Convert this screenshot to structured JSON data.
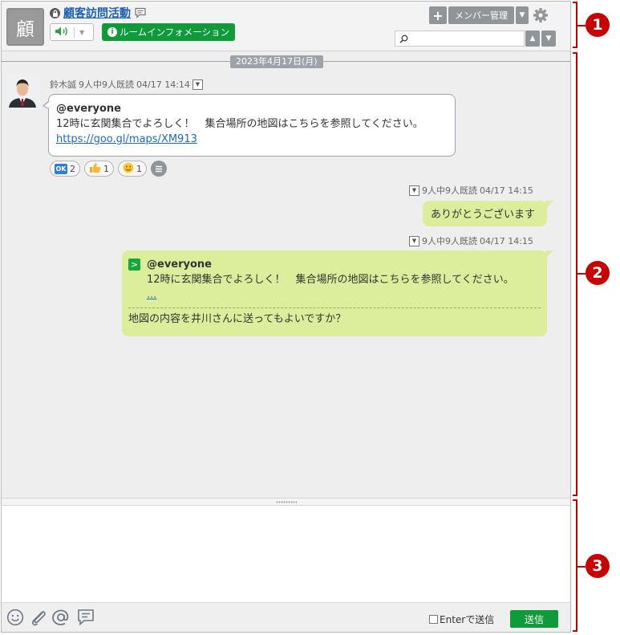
{
  "header": {
    "room_avatar_text": "顧",
    "room_title": "顧客訪問活動",
    "room_info_label": "ルームインフォメーション",
    "member_manage_label": "メンバー管理",
    "search_placeholder": ""
  },
  "timeline": {
    "date_label": "2023年4月17日(月)",
    "messages": [
      {
        "sender": "鈴木誠",
        "read_status": "9人中9人既読",
        "timestamp": "04/17 14:14",
        "mention": "@everyone",
        "body": "12時に玄関集合でよろしく！　集合場所の地図はこちらを参照してください。",
        "link": "https://goo.gl/maps/XM913",
        "reactions": [
          {
            "icon": "ok-icon",
            "count": "2"
          },
          {
            "icon": "thumbs-up-icon",
            "count": "1"
          },
          {
            "icon": "smile-icon",
            "count": "1"
          }
        ]
      },
      {
        "read_status": "9人中9人既読",
        "timestamp": "04/17 14:15",
        "body": "ありがとうございます"
      },
      {
        "read_status": "9人中9人既読",
        "timestamp": "04/17 14:15",
        "quote_mention": "@everyone",
        "quote_body": "12時に玄関集合でよろしく！　集合場所の地図はこちらを参照してください。",
        "quote_ellipsis": "...",
        "body": "地図の内容を井川さんに送ってもよいですか？"
      }
    ]
  },
  "composer": {
    "value": "",
    "enter_send_label": "Enterで送信",
    "send_label": "送信"
  },
  "callouts": [
    "1",
    "2",
    "3"
  ],
  "colors": {
    "accent_green": "#0f9b3a",
    "bubble_green": "#dcee9b",
    "link_blue": "#1a6bc5",
    "callout_red": "#c70000"
  }
}
